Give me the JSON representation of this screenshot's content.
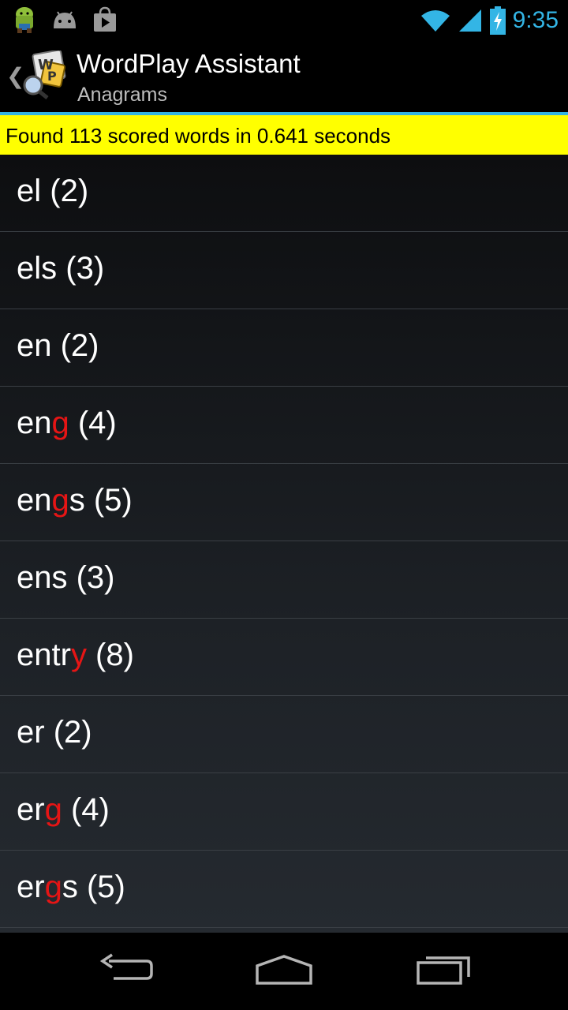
{
  "status_bar": {
    "time": "9:35",
    "icons": [
      "android-bot-icon",
      "android-head-icon",
      "play-store-icon",
      "wifi-icon",
      "signal-icon",
      "battery-charging-icon"
    ]
  },
  "action_bar": {
    "title": "WordPlay Assistant",
    "subtitle": "Anagrams",
    "app_icon": "wordplay-app-icon",
    "up_icon": "chevron-left-icon"
  },
  "banner": {
    "text": "Found 113 scored words in 0.641 seconds"
  },
  "colors": {
    "accent": "#33b5e5",
    "banner_bg": "#ffff00",
    "highlight": "#e51515"
  },
  "results": [
    {
      "word": "el",
      "highlight_index": -1,
      "score_text": " (2)"
    },
    {
      "word": "els",
      "highlight_index": -1,
      "score_text": " (3)"
    },
    {
      "word": "en",
      "highlight_index": -1,
      "score_text": " (2)"
    },
    {
      "word": "eng",
      "highlight_index": 2,
      "score_text": " (4)"
    },
    {
      "word": "engs",
      "highlight_index": 2,
      "score_text": " (5)"
    },
    {
      "word": "ens",
      "highlight_index": -1,
      "score_text": " (3)"
    },
    {
      "word": "entry",
      "highlight_index": 4,
      "score_text": " (8)"
    },
    {
      "word": "er",
      "highlight_index": -1,
      "score_text": " (2)"
    },
    {
      "word": "erg",
      "highlight_index": 2,
      "score_text": " (4)"
    },
    {
      "word": "ergs",
      "highlight_index": 2,
      "score_text": " (5)"
    }
  ],
  "nav_bar": {
    "buttons": [
      "back-icon",
      "home-icon",
      "recents-icon"
    ]
  }
}
